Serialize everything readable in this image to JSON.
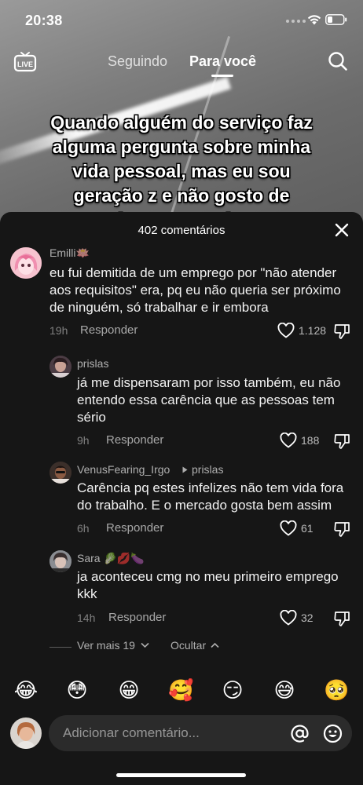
{
  "status_bar": {
    "time": "20:38"
  },
  "nav": {
    "live_label": "LIVE",
    "following_label": "Seguindo",
    "for_you_label": "Para você"
  },
  "caption": "Quando alguém do serviço faz alguma pergunta sobre minha vida pessoal, mas eu sou geração z e não gosto de misturar as coisas",
  "sheet": {
    "title": "402 comentários"
  },
  "comments": [
    {
      "author": "Emilli🪷",
      "text": "eu fui demitida de um emprego por \"não atender aos requisitos\" era, pq eu não queria ser próximo de ninguém, só trabalhar e ir embora",
      "time": "19h",
      "reply_label": "Responder",
      "likes": "1.128"
    },
    {
      "author": "prislas",
      "text": "já me dispensaram por isso também, eu não entendo essa carência que as pessoas tem sério",
      "time": "9h",
      "reply_label": "Responder",
      "likes": "188"
    },
    {
      "author": "VenusFearing_Irgo",
      "reply_to": "prislas",
      "text": "Carência pq estes infelizes não tem vida fora do trabalho. E o mercado gosta bem assim",
      "time": "6h",
      "reply_label": "Responder",
      "likes": "61"
    },
    {
      "author": "Sara 🥬💋🍆",
      "text": "ja aconteceu cmg no meu primeiro emprego kkk",
      "time": "14h",
      "reply_label": "Responder",
      "likes": "32"
    }
  ],
  "thread_controls": {
    "view_more_label": "Ver mais 19",
    "hide_label": "Ocultar"
  },
  "emoji_bar": [
    "😂",
    "😳",
    "😁",
    "🥰",
    "😏",
    "😅",
    "🥺"
  ],
  "composer": {
    "placeholder": "Adicionar comentário..."
  },
  "colors": {
    "sheet_background": "#161616",
    "input_background": "#2b2b2b"
  }
}
